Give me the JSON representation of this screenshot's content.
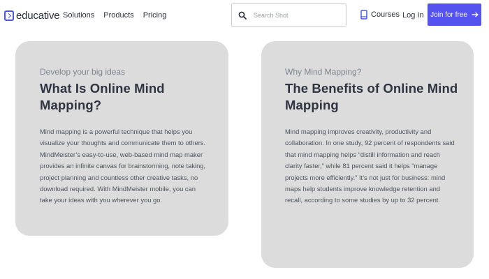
{
  "header": {
    "logo_text": "educative",
    "nav": [
      "Solutions",
      "Products",
      "Pricing"
    ],
    "search_placeholder": "Search Shot",
    "courses_label": "Courses",
    "login_label": "Log In",
    "join_label": "Join for free",
    "brand_color": "#5553f0"
  },
  "cards": {
    "left": {
      "eyebrow": "Develop your big ideas",
      "title": "What Is Online Mind Mapping?",
      "body": "Mind mapping is a powerful technique that helps you visualize your thoughts and communicate them to others. MindMeister’s easy-to-use, web-based mind map maker provides an infinite canvas for brainstorming, note taking, project planning and countless other creative tasks, no download required. With MindMeister mobile, you can take your ideas with you wherever you go."
    },
    "right": {
      "eyebrow": "Why Mind Mapping?",
      "title": "The Benefits of Online Mind Mapping",
      "body": "Mind mapping improves creativity, productivity and collaboration. In one study, 92 percent of respondents said that mind mapping helps “distill information and reach clarity faster,” while 81 percent said it helps “manage projects more efficiently.” It’s not just for business: mind maps help students improve knowledge retention and recall, according to some studies by up to 32 percent."
    }
  }
}
